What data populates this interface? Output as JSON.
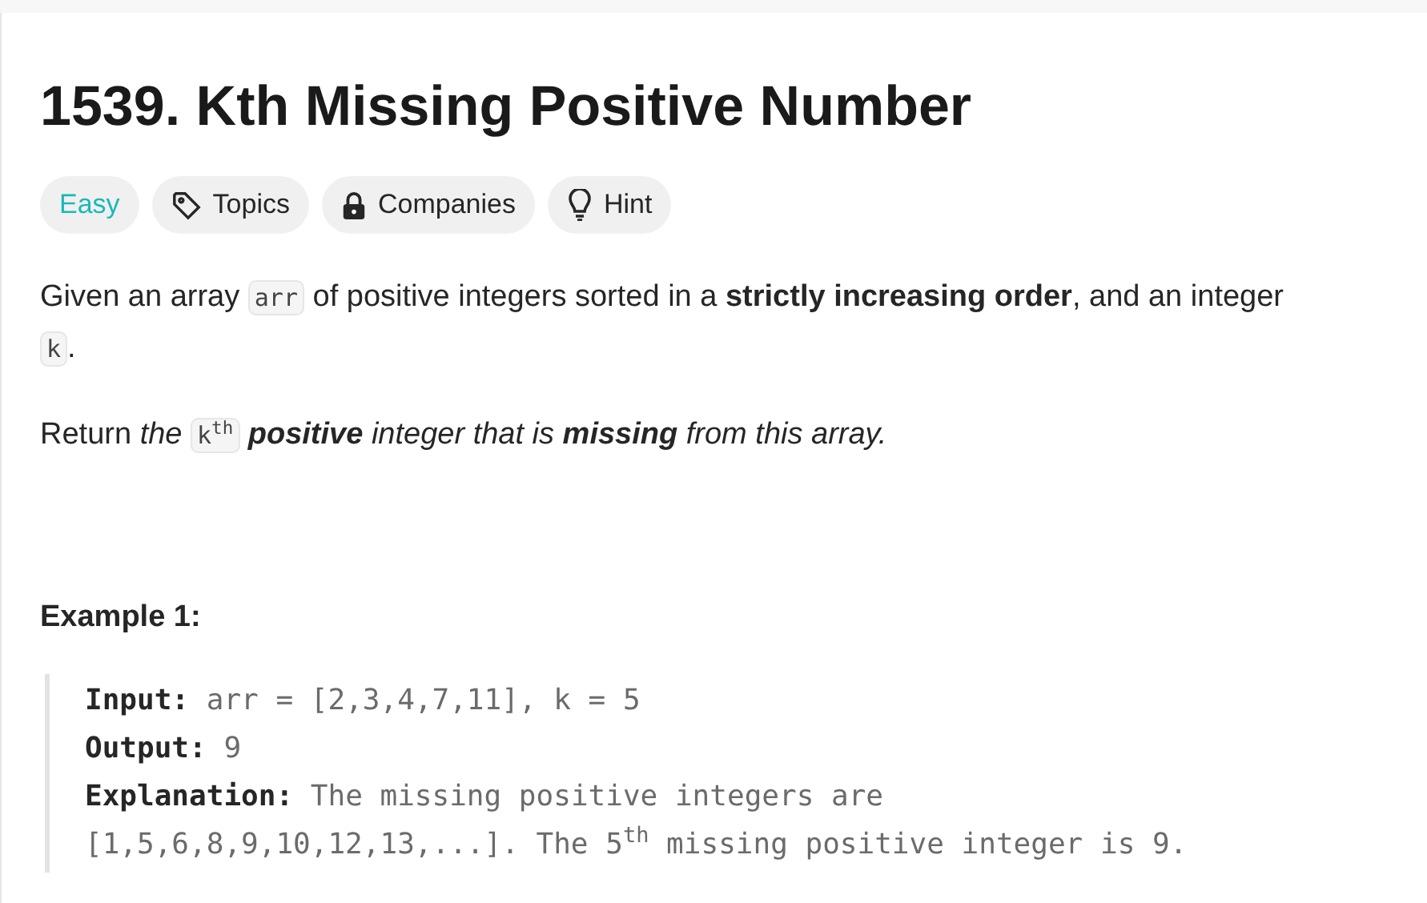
{
  "title": "1539. Kth Missing Positive Number",
  "tags": [
    {
      "kind": "difficulty",
      "label": "Easy"
    },
    {
      "kind": "topics",
      "label": "Topics"
    },
    {
      "kind": "companies",
      "label": "Companies"
    },
    {
      "kind": "hint",
      "label": "Hint"
    }
  ],
  "paragraphs": [
    [
      {
        "kind": "text",
        "text": "Given an array "
      },
      {
        "kind": "code",
        "text": "arr"
      },
      {
        "kind": "text",
        "text": " of positive integers sorted in a **strictly increasing order**, and an integer "
      },
      {
        "kind": "code",
        "text": "k"
      },
      {
        "kind": "text",
        "text": "."
      }
    ],
    [
      {
        "kind": "text",
        "text": "Return "
      },
      {
        "kind": "italic",
        "text": "the "
      },
      {
        "kind": "code",
        "text": "k$^{th}$"
      },
      {
        "kind": "bolditalic",
        "text": " positive"
      },
      {
        "kind": "italic",
        "text": " integer that is "
      },
      {
        "kind": "bolditalic",
        "text": "missing"
      },
      {
        "kind": "italic",
        "text": " from this array."
      }
    ]
  ],
  "example": {
    "heading": "Example 1:",
    "lines": [
      {
        "label": "Input:",
        "value": "arr = [2,3,4,7,11], k = 5"
      },
      {
        "label": "Output:",
        "value": "9"
      },
      {
        "label": "Explanation:",
        "value": "The missing positive integers are"
      },
      {
        "value": "[1,5,6,8,9,10,12,13,...]. The 5$^{th}$ missing positive integer is 9."
      }
    ]
  }
}
